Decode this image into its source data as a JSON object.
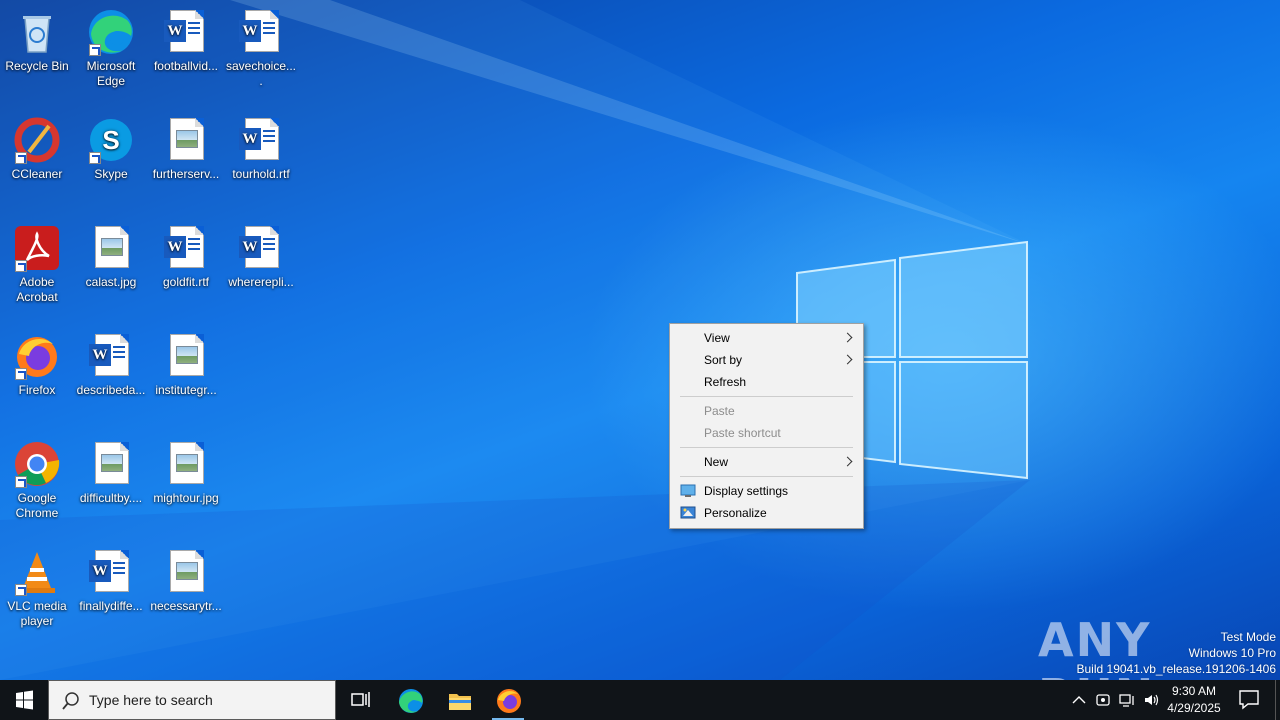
{
  "desktop": {
    "icons": [
      {
        "label": "Recycle Bin",
        "icon": "recycle-bin-icon"
      },
      {
        "label": "Microsoft Edge",
        "icon": "edge-icon"
      },
      {
        "label": "footballvid...",
        "icon": "word-doc-icon"
      },
      {
        "label": "savechoice....",
        "icon": "word-doc-icon"
      },
      {
        "label": "CCleaner",
        "icon": "ccleaner-icon"
      },
      {
        "label": "Skype",
        "icon": "skype-icon"
      },
      {
        "label": "furtherserv...",
        "icon": "image-file-icon"
      },
      {
        "label": "tourhold.rtf",
        "icon": "word-doc-icon"
      },
      {
        "label": "Adobe Acrobat",
        "icon": "acrobat-icon"
      },
      {
        "label": "calast.jpg",
        "icon": "image-file-icon"
      },
      {
        "label": "goldfit.rtf",
        "icon": "word-doc-icon"
      },
      {
        "label": "whererepli...",
        "icon": "word-doc-icon"
      },
      {
        "label": "Firefox",
        "icon": "firefox-icon"
      },
      {
        "label": "describeda...",
        "icon": "word-doc-icon"
      },
      {
        "label": "institutegr...",
        "icon": "image-file-icon"
      },
      {
        "label": "Google Chrome",
        "icon": "chrome-icon"
      },
      {
        "label": "difficultby....",
        "icon": "image-file-icon"
      },
      {
        "label": "mightour.jpg",
        "icon": "image-file-icon"
      },
      {
        "label": "VLC media player",
        "icon": "vlc-icon"
      },
      {
        "label": "finallydiffe...",
        "icon": "word-doc-icon"
      },
      {
        "label": "necessarytr...",
        "icon": "image-file-icon"
      }
    ]
  },
  "context_menu": {
    "view": "View",
    "sort_by": "Sort by",
    "refresh": "Refresh",
    "paste": "Paste",
    "paste_shortcut": "Paste shortcut",
    "new": "New",
    "display_settings": "Display settings",
    "personalize": "Personalize"
  },
  "watermark": {
    "logo": "ANY RUN",
    "line1": "Test Mode",
    "line2": "Windows 10 Pro",
    "line3": "Build 19041.vb_release.191206-1406"
  },
  "taskbar": {
    "search_placeholder": "Type here to search",
    "time": "9:30 AM",
    "date": "4/29/2025",
    "accent": "#76b9ed"
  }
}
